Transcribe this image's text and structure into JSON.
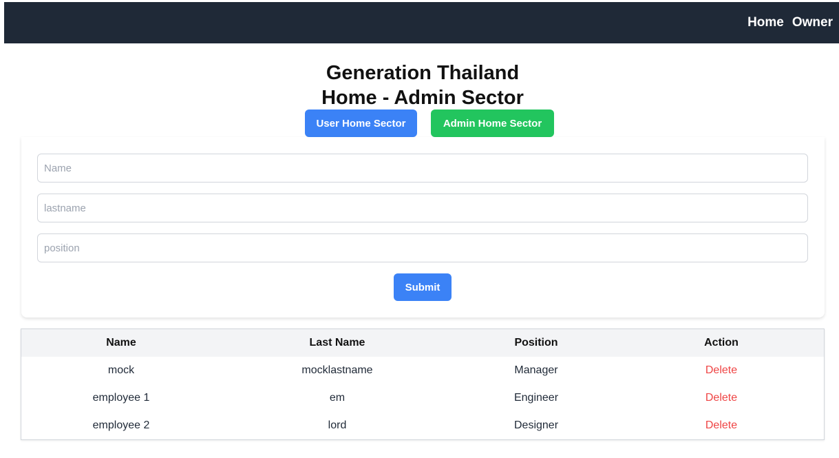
{
  "navbar": {
    "links": [
      "Home",
      "Owner"
    ]
  },
  "heading": {
    "line1": "Generation Thailand",
    "line2": "Home - Admin Sector"
  },
  "sector_buttons": {
    "user": "User Home Sector",
    "admin": "Admin Home Sector"
  },
  "form": {
    "name_placeholder": "Name",
    "lastname_placeholder": "lastname",
    "position_placeholder": "position",
    "name_value": "",
    "lastname_value": "",
    "position_value": "",
    "submit_label": "Submit"
  },
  "table": {
    "headers": [
      "Name",
      "Last Name",
      "Position",
      "Action"
    ],
    "rows": [
      {
        "name": "mock",
        "lastname": "mocklastname",
        "position": "Manager",
        "action": "Delete"
      },
      {
        "name": "employee 1",
        "lastname": "em",
        "position": "Engineer",
        "action": "Delete"
      },
      {
        "name": "employee 2",
        "lastname": "lord",
        "position": "Designer",
        "action": "Delete"
      }
    ]
  },
  "colors": {
    "navbar_bg": "#1f2937",
    "primary_blue": "#3b82f6",
    "primary_green": "#22c55e",
    "delete_red": "#ef4444",
    "table_header_bg": "#f3f4f6"
  }
}
